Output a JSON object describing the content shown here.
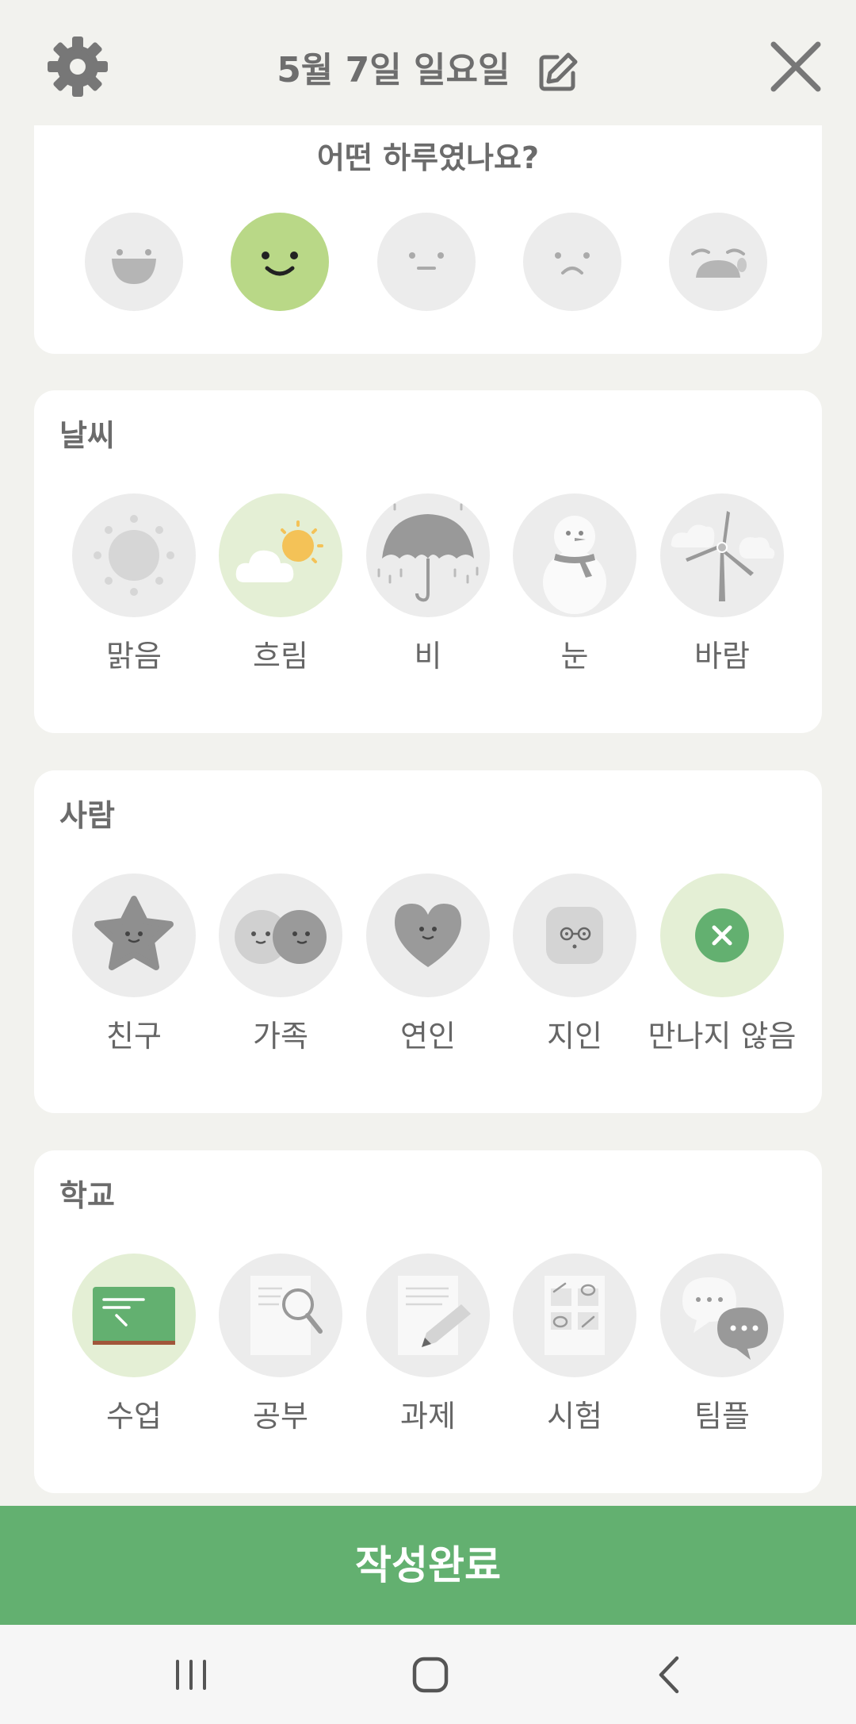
{
  "header": {
    "title": "5월 7일 일요일",
    "settings_icon": "gear-icon",
    "edit_icon": "pencil-edit-icon",
    "close_icon": "close-icon"
  },
  "mood": {
    "question": "어떤 하루였나요?",
    "faces": [
      {
        "name": "very-happy",
        "selected": false
      },
      {
        "name": "happy",
        "selected": true
      },
      {
        "name": "neutral",
        "selected": false
      },
      {
        "name": "sad",
        "selected": false
      },
      {
        "name": "very-sad",
        "selected": false
      }
    ]
  },
  "weather": {
    "title": "날씨",
    "options": [
      {
        "label": "맑음",
        "icon": "sun-icon",
        "selected": false
      },
      {
        "label": "흐림",
        "icon": "cloud-sun-icon",
        "selected": true
      },
      {
        "label": "비",
        "icon": "umbrella-rain-icon",
        "selected": false
      },
      {
        "label": "눈",
        "icon": "snowman-icon",
        "selected": false
      },
      {
        "label": "바람",
        "icon": "wind-turbine-icon",
        "selected": false
      }
    ]
  },
  "people": {
    "title": "사람",
    "options": [
      {
        "label": "친구",
        "icon": "star-face-icon",
        "selected": false
      },
      {
        "label": "가족",
        "icon": "family-faces-icon",
        "selected": false
      },
      {
        "label": "연인",
        "icon": "heart-face-icon",
        "selected": false
      },
      {
        "label": "지인",
        "icon": "glasses-face-icon",
        "selected": false
      },
      {
        "label": "만나지 않음",
        "icon": "x-circle-icon",
        "selected": true
      }
    ]
  },
  "school": {
    "title": "학교",
    "options": [
      {
        "label": "수업",
        "icon": "chalkboard-icon",
        "selected": true
      },
      {
        "label": "공부",
        "icon": "magnifier-paper-icon",
        "selected": false
      },
      {
        "label": "과제",
        "icon": "pencil-paper-icon",
        "selected": false
      },
      {
        "label": "시험",
        "icon": "exam-sheet-icon",
        "selected": false
      },
      {
        "label": "팀플",
        "icon": "chat-bubbles-icon",
        "selected": false
      }
    ]
  },
  "footer": {
    "complete_label": "작성완료"
  },
  "colors": {
    "accent": "#63b070",
    "selected_face": "#b9d887",
    "selected_bg": "#e4efd5"
  }
}
